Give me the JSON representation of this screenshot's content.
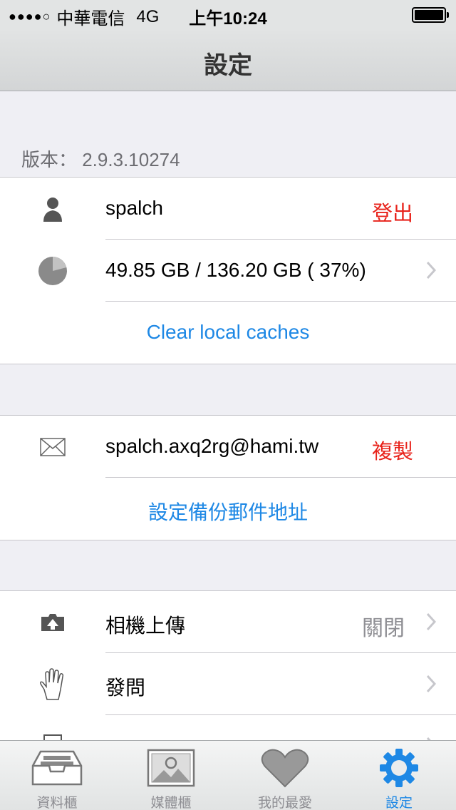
{
  "status_bar": {
    "signal": "●●●●○",
    "carrier": "中華電信",
    "network": "4G",
    "time": "上午10:24"
  },
  "nav": {
    "title": "設定"
  },
  "version": "版本： 2.9.3.10274",
  "account": {
    "username": "spalch",
    "logout_label": "登出",
    "storage": "49.85 GB / 136.20 GB ( 37%)",
    "storage_used_fraction": 0.37,
    "clear_cache_label": "Clear local caches"
  },
  "email": {
    "address": "spalch.axq2rg@hami.tw",
    "copy_label": "複製",
    "set_backup_label": "設定備份郵件地址"
  },
  "settings": {
    "camera_upload_label": "相機上傳",
    "camera_upload_value": "關閉",
    "faq_label": "發問"
  },
  "tabs": [
    {
      "label": "資料櫃",
      "icon": "cabinet-icon"
    },
    {
      "label": "媒體櫃",
      "icon": "photo-icon"
    },
    {
      "label": "我的最愛",
      "icon": "heart-icon"
    },
    {
      "label": "設定",
      "icon": "gear-icon"
    }
  ],
  "colors": {
    "accent_blue": "#1e88e5",
    "destructive_red": "#e8231b"
  }
}
